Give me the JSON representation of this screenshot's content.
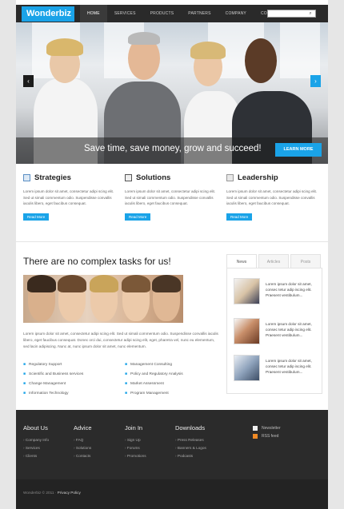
{
  "header": {
    "logo": "Wonderbiz",
    "nav": [
      "HOME",
      "SERVICES",
      "PRODUCTS",
      "PARTNERS",
      "COMPANY",
      "CONTACTS"
    ],
    "search_icon": "search-icon"
  },
  "hero": {
    "caption": "Save time, save money, grow and succeed!",
    "button": "LEARN MORE",
    "prev": "‹",
    "next": "›"
  },
  "features": [
    {
      "title": "Strategies",
      "text": "Lorem ipsum dolor sit amet, consectetur adipi scing elit. Sed ut simali commentum odio. Suspendisse convallis iaculis libero, eget faucibus consequat.",
      "button": "Read More"
    },
    {
      "title": "Solutions",
      "text": "Lorem ipsum dolor sit amet, consectetur adipi scing elit. Sed ut simali commentum odio. Suspendisse convallis iaculis libero, eget faucibus consequat.",
      "button": "Read More"
    },
    {
      "title": "Leadership",
      "text": "Lorem ipsum dolor sit amet, consectetur adipi scing elit. Sed ut simali commentum odio. Suspendisse convallis iaculis libero, eget faucibus consequat.",
      "button": "Read More"
    }
  ],
  "main": {
    "title": "There are no complex tasks for us!",
    "text": "Lorem ipsum dolor sit amet, consectetur adipi scing elit. Sed ut simali commentum odio. Suspendisse convallis iaculis libero, eget faucibus consequat. Donec orci dui, consectetur adipi scing elit, eget, pharetra vel, nunc eu elementum, sed lacin adipiscing. Nunc at, nunc ipsum dolor sit amet, nunc elementum.",
    "list_left": [
      "Regulatory Support",
      "Scientific and Business services",
      "Change Management",
      "Information Technology"
    ],
    "list_right": [
      "Management Consulting",
      "Policy and Regulatory Analysis",
      "Market Assessment",
      "Program Management"
    ]
  },
  "tabs": {
    "labels": [
      "News",
      "Articles",
      "Posts"
    ],
    "news": [
      {
        "text": "Lorem ipsum dolor sit amet, consec tetur adip iscing elit. Praesent vestibulum..."
      },
      {
        "text": "Lorem ipsum dolor sit amet, consec tetur adip iscing elit. Praesent vestibulum..."
      },
      {
        "text": "Lorem ipsum dolor sit amet, consec tetur adip iscing elit. Praesent vestibulum..."
      }
    ]
  },
  "footer": {
    "columns": [
      {
        "title": "About Us",
        "links": [
          "Company Info",
          "Services",
          "Clients"
        ]
      },
      {
        "title": "Advice",
        "links": [
          "FAQ",
          "Solutions",
          "Contacts"
        ]
      },
      {
        "title": "Join In",
        "links": [
          "Sign Up",
          "Forums",
          "Promotions"
        ]
      },
      {
        "title": "Downloads",
        "links": [
          "Press Releases",
          "Banners & Logos",
          "Podcasts"
        ]
      }
    ],
    "social": [
      "Newsletter",
      "RSS feed"
    ],
    "copyright": "Wonderbiz © 2011",
    "privacy": "Privacy Policy"
  },
  "colors": {
    "accent": "#1aa3e8",
    "header_bg": "#2a2a2a",
    "footer_bg": "#2b2b2b"
  }
}
